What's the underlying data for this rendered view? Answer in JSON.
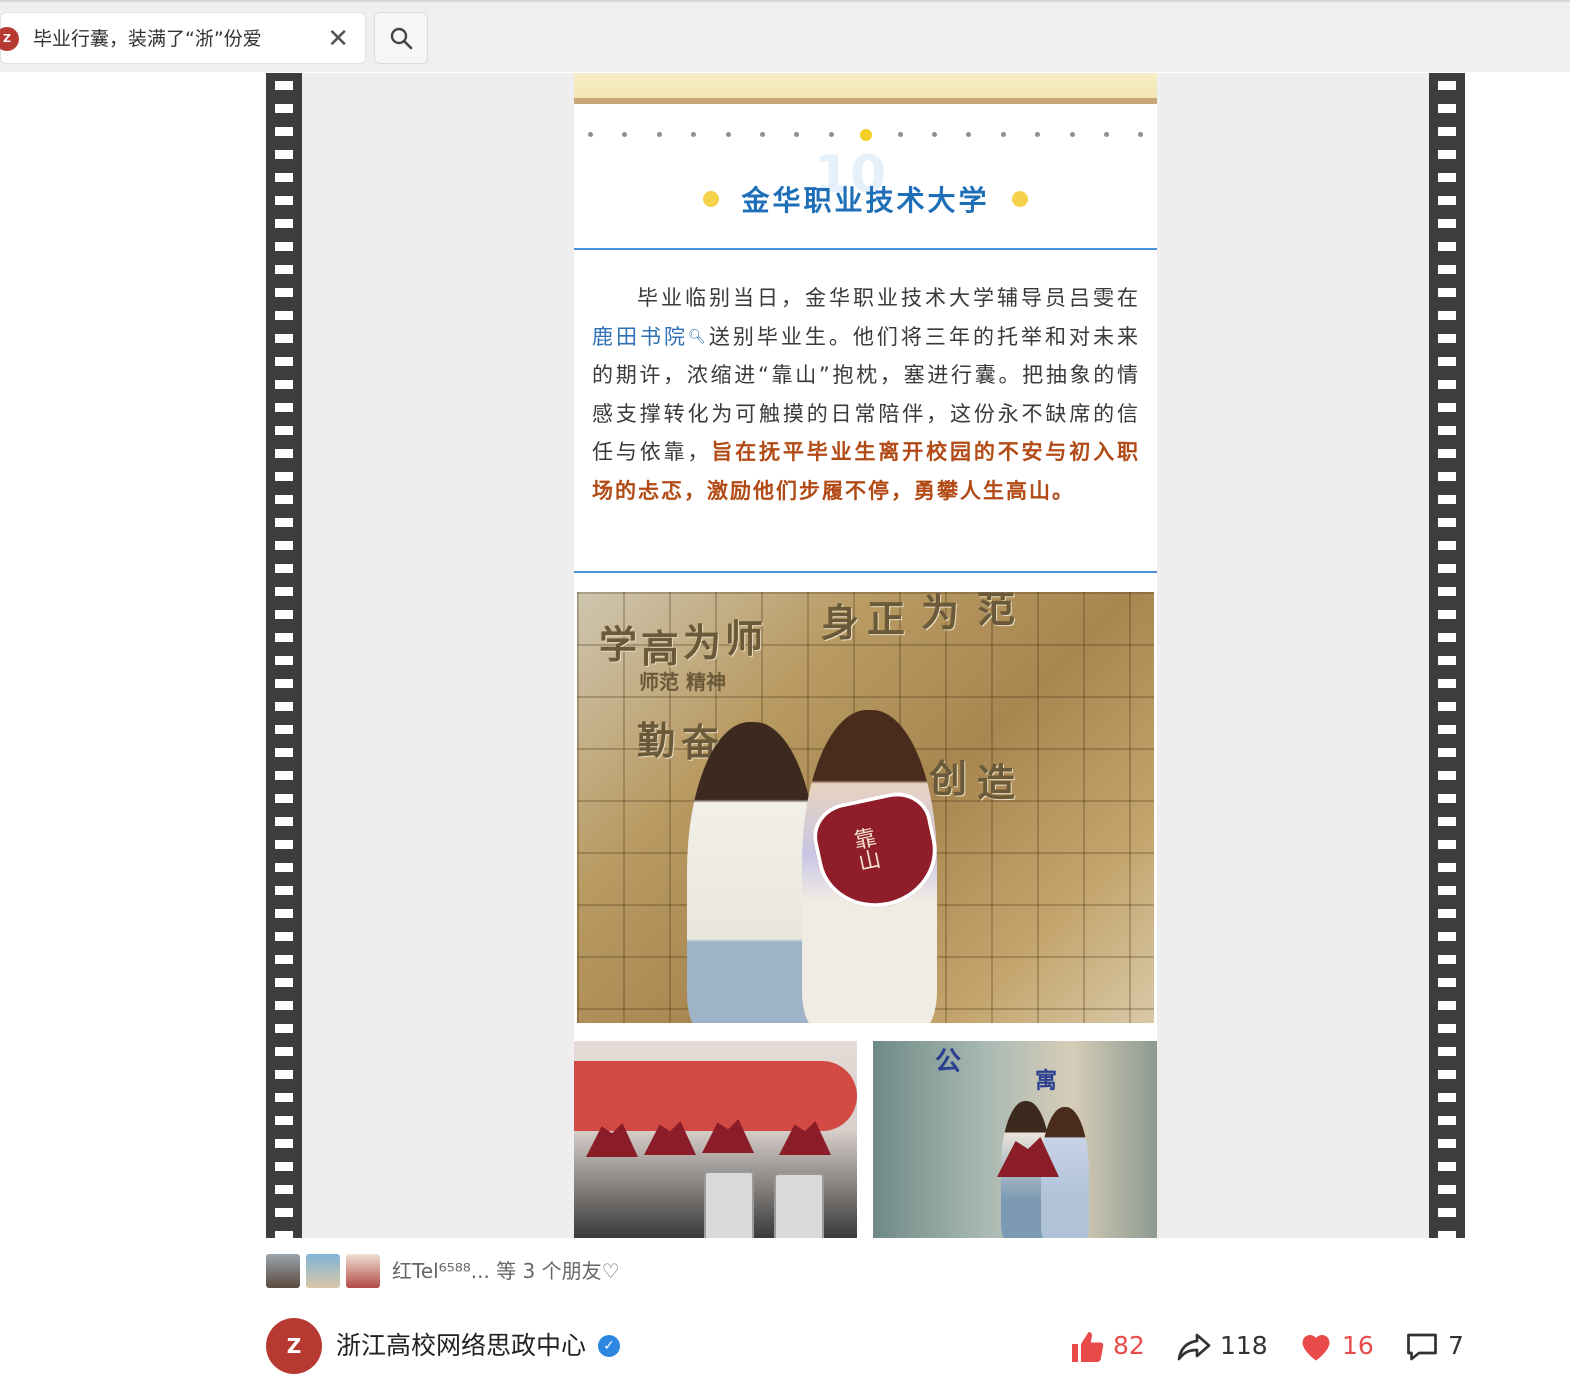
{
  "search": {
    "logo_text": "Z",
    "query": "毕业行囊，装满了“浙”份爱",
    "clear_symbol": "✕"
  },
  "article": {
    "section_number": "10",
    "title": "金华职业技术大学",
    "paragraph": {
      "intro": "毕业临别当日，金华职业技术大学辅导员吕雯在",
      "link": "鹿田书院",
      "middle": "送别毕业生。他们将三年的托举和对未来的期许，浓缩进“靠山”抱枕，塞进行囊。把抽象的情感支撑转化为可触摸的日常陪伴，这份永不缺席的信任与依靠，",
      "highlight": "旨在抚平毕业生离开校园的不安与初入职场的忐忑，激励他们步履不停，勇攀人生高山。"
    },
    "photo_main_sign": [
      "学",
      "高",
      "为",
      "师",
      "身",
      "正",
      "为",
      "范",
      "勤",
      "奋",
      "创",
      "造"
    ],
    "photo_main_sub": "师范 精神",
    "pillow_text": "靠山",
    "photo_b_sign_1": "公",
    "photo_b_sign_2": "寓",
    "carousel": {
      "total": 17,
      "active_index": 8
    }
  },
  "footer": {
    "friends_text": "红Tel⁶⁵⁸⁸... 等 3 个朋友♡",
    "account_name": "浙江高校网络思政中心",
    "account_logo_text": "Z",
    "likes": "82",
    "shares": "118",
    "hearts": "16",
    "comments": "7"
  },
  "colors": {
    "title_blue": "#1e6fb7",
    "highlight_brown": "#b24a16",
    "link_blue": "#2f6fb4",
    "accent_red": "#e94b4b",
    "film_dark": "#3d3d3d"
  }
}
